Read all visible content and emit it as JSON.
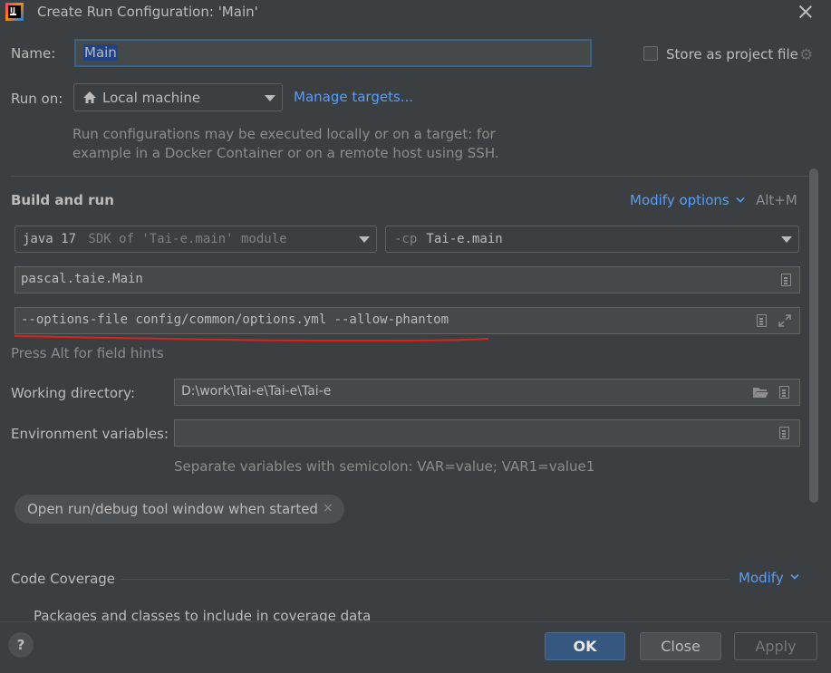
{
  "window": {
    "title": "Create Run Configuration: 'Main'"
  },
  "name": {
    "label": "Name:",
    "value": "Main"
  },
  "store": {
    "label": "Store as project file",
    "checked": false
  },
  "run_on": {
    "label": "Run on:",
    "value": "Local machine",
    "manage_link": "Manage targets...",
    "description_line1": "Run configurations may be executed locally or on a target: for",
    "description_line2": "example in a Docker Container or on a remote host using SSH."
  },
  "build_and_run": {
    "heading": "Build and run",
    "modify_options": "Modify options",
    "modify_shortcut": "Alt+M",
    "sdk_strong": "java 17",
    "sdk_rest": " SDK of 'Tai-e.main' module",
    "cp_prefix": "-cp",
    "cp_value": " Tai-e.main",
    "main_class": "pascal.taie.Main",
    "program_args": "--options-file config/common/options.yml --allow-phantom",
    "field_hint": "Press Alt for field hints"
  },
  "working_directory": {
    "label": "Working directory:",
    "value": "D:\\work\\Tai-e\\Tai-e\\Tai-e"
  },
  "environment": {
    "label": "Environment variables:",
    "value": "",
    "hint": "Separate variables with semicolon: VAR=value; VAR1=value1"
  },
  "chip": {
    "label": "Open run/debug tool window when started"
  },
  "coverage": {
    "heading": "Code Coverage",
    "modify": "Modify",
    "packages_label": "Packages and classes to include in coverage data"
  },
  "buttons": {
    "ok": "OK",
    "close": "Close",
    "apply": "Apply",
    "help": "?"
  },
  "colors": {
    "accent": "#589df6",
    "ok_button": "#365880",
    "annotation_underline": "#e0201c"
  }
}
